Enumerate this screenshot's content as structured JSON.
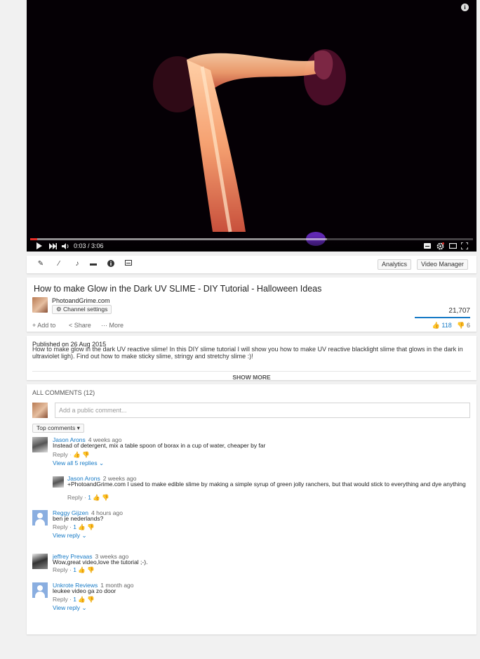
{
  "player": {
    "time_current": "0:03",
    "time_total": "3:06",
    "progress_played": 0.016,
    "progress_buffered": 0.67,
    "accent_color": "#e52d27"
  },
  "toolbar": {
    "icons": [
      "pencil-icon",
      "magic-wand-icon",
      "music-note-icon",
      "speech-bubble-icon",
      "info-circle-icon",
      "subtitles-icon"
    ],
    "analytics_label": "Analytics",
    "video_manager_label": "Video Manager"
  },
  "video": {
    "title": "How to make Glow in the Dark UV SLIME - DIY Tutorial - Halloween Ideas",
    "channel_name": "PhotoandGrime.com",
    "channel_settings_label": "Channel settings",
    "views": "21,707",
    "add_to_label": "Add to",
    "share_label": "Share",
    "more_label": "More",
    "likes": "118",
    "dislikes": "6"
  },
  "description": {
    "published": "Published on 26 Aug 2015",
    "text": "How to make glow in the dark UV reactive slime! In this DIY slime tutorial I will show you how to make UV reactive blacklight slime that glows in the dark in ultraviolet ligh). Find out how to make sticky slime, stringy and stretchy slime :)!",
    "show_more": "SHOW MORE"
  },
  "comments": {
    "header": "ALL COMMENTS (12)",
    "placeholder": "Add a public comment...",
    "sort_label": "Top comments",
    "reply_label": "Reply",
    "items": [
      {
        "author": "Jason Arons",
        "time": "4 weeks ago",
        "text": "Instead of detergent, mix a table spoon of borax in a cup of water, cheaper by far",
        "likes": "",
        "view_replies": "View all 5 replies"
      },
      {
        "author": "Jason Arons",
        "time": "2 weeks ago",
        "text": "+PhotoandGrime.com I used to make edible slime by making a simple syrup of green jolly ranchers, but that would stick to everything and dye anything",
        "likes": "1",
        "view_replies": ""
      },
      {
        "author": "Reggy Gijzen",
        "time": "4 hours ago",
        "text": "ben je nederlands?",
        "likes": "1",
        "view_replies": "View reply"
      },
      {
        "author": "jeffrey Prevaas",
        "time": "3 weeks ago",
        "text": "Wow,great video,love the tutorial ;-).",
        "likes": "1",
        "view_replies": ""
      },
      {
        "author": "Unkrote Reviews",
        "time": "1 month ago",
        "text": "leukee video ga zo door",
        "likes": "1",
        "view_replies": "View reply"
      }
    ]
  }
}
